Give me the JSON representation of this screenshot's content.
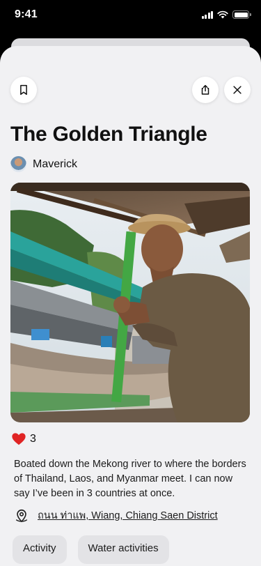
{
  "status_bar": {
    "time": "9:41"
  },
  "post": {
    "title": "The Golden Triangle",
    "author": {
      "name": "Maverick"
    },
    "likes": "3",
    "description": "Boated down the Mekong river to where the borders of Thailand, Laos, and Myanmar meet. I can now say I’ve been in 3 countries at once.",
    "location": "ถนน ท่าแพ, Wiang, Chiang Saen District",
    "tags": [
      "Activity",
      "Water activities"
    ]
  },
  "icons": {
    "bookmark": "bookmark-icon",
    "share": "share-icon",
    "close": "close-icon",
    "heart": "heart-icon",
    "location": "map-pin-icon"
  },
  "colors": {
    "heart": "#e02424",
    "sheet_background": "#f1f1f3",
    "tag_background": "#e3e3e6"
  }
}
